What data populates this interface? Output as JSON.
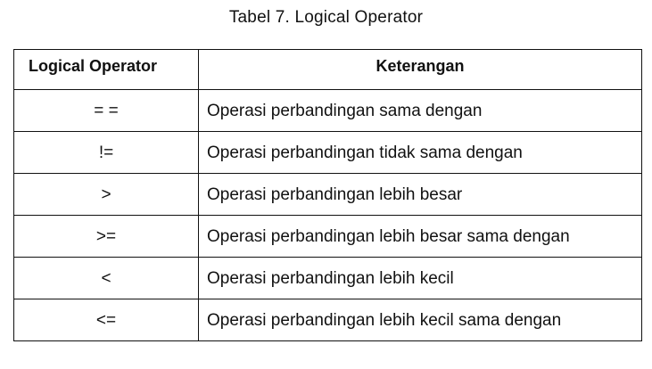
{
  "caption": "Tabel 7. Logical Operator",
  "table": {
    "headers": [
      "Logical Operator",
      "Keterangan"
    ],
    "rows": [
      {
        "operator": "= =",
        "description": "Operasi perbandingan sama dengan"
      },
      {
        "operator": "!=",
        "description": "Operasi perbandingan tidak sama dengan"
      },
      {
        "operator": ">",
        "description": "Operasi perbandingan lebih besar"
      },
      {
        "operator": ">=",
        "description": "Operasi perbandingan lebih besar sama dengan"
      },
      {
        "operator": "<",
        "description": "Operasi perbandingan lebih kecil"
      },
      {
        "operator": "<=",
        "description": "Operasi perbandingan lebih kecil sama dengan"
      }
    ]
  }
}
